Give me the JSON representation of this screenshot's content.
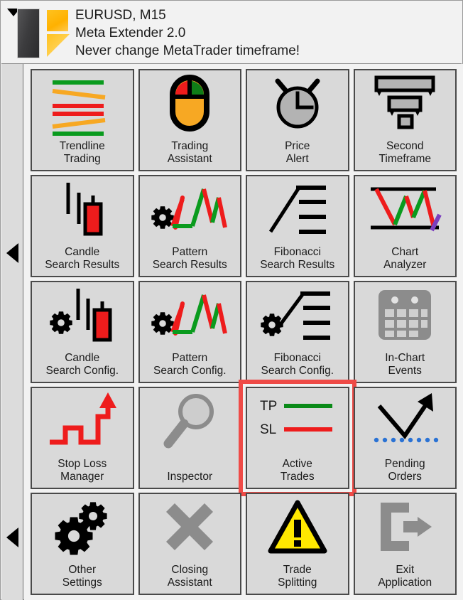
{
  "header": {
    "caret_icon": "chevron-down-icon",
    "logo_icon": "meta-extender-logo",
    "line1": "EURUSD, M15",
    "line2": "Meta Extender 2.0",
    "line3": "Never change MetaTrader timeframe!"
  },
  "rail": {
    "caret_top_icon": "chevron-left-icon",
    "caret_bottom_icon": "chevron-left-icon"
  },
  "colors": {
    "panel_bg": "#f2f2f2",
    "tile_bg": "#d9d9d9",
    "tile_border": "#4a4a4a",
    "rail_bg": "#dcdcdc",
    "selection": "#ef4b47",
    "green": "#0a9b1e",
    "red": "#ee1c1c",
    "orange": "#f7a823",
    "yellow": "#ffe800",
    "purple": "#7b3fbf",
    "blue_dot": "#2a72d4",
    "gray_icon": "#8c8c8c",
    "black": "#000000"
  },
  "tiles": [
    {
      "id": "trendline-trading",
      "icon": "trendlines-icon",
      "label": "Trendline\nTrading",
      "selected": false,
      "disabled": false
    },
    {
      "id": "trading-assistant",
      "icon": "mouse-icon",
      "label": "Trading\nAssistant",
      "selected": false,
      "disabled": false
    },
    {
      "id": "price-alert",
      "icon": "alarm-clock-icon",
      "label": "Price\nAlert",
      "selected": false,
      "disabled": false
    },
    {
      "id": "second-timeframe",
      "icon": "funnel-icon",
      "label": "Second\nTimeframe",
      "selected": false,
      "disabled": false
    },
    {
      "id": "candle-search-results",
      "icon": "candlestick-icon",
      "label": "Candle\nSearch Results",
      "selected": false,
      "disabled": false
    },
    {
      "id": "pattern-search-results",
      "icon": "zigzag-gear-icon",
      "label": "Pattern\nSearch Results",
      "selected": false,
      "disabled": false
    },
    {
      "id": "fibonacci-search-results",
      "icon": "fibonacci-icon",
      "label": "Fibonacci\nSearch Results",
      "selected": false,
      "disabled": false
    },
    {
      "id": "chart-analyzer",
      "icon": "chart-analyzer-icon",
      "label": "Chart\nAnalyzer",
      "selected": false,
      "disabled": false
    },
    {
      "id": "candle-search-config",
      "icon": "candlestick-gear-icon",
      "label": "Candle\nSearch Config.",
      "selected": false,
      "disabled": false
    },
    {
      "id": "pattern-search-config",
      "icon": "zigzag-gear-icon",
      "label": "Pattern\nSearch Config.",
      "selected": false,
      "disabled": false
    },
    {
      "id": "fibonacci-search-config",
      "icon": "fibonacci-gear-icon",
      "label": "Fibonacci\nSearch Config.",
      "selected": false,
      "disabled": false
    },
    {
      "id": "in-chart-events",
      "icon": "calendar-icon",
      "label": "In-Chart\nEvents",
      "selected": false,
      "disabled": true
    },
    {
      "id": "stop-loss-manager",
      "icon": "staircase-arrow-icon",
      "label": "Stop Loss\nManager",
      "selected": false,
      "disabled": false
    },
    {
      "id": "inspector",
      "icon": "magnifier-icon",
      "label": "Inspector",
      "selected": false,
      "disabled": false
    },
    {
      "id": "active-trades",
      "icon": "tp-sl-lines-icon",
      "label": "Active\nTrades",
      "selected": true,
      "disabled": false
    },
    {
      "id": "pending-orders",
      "icon": "pending-arrow-icon",
      "label": "Pending\nOrders",
      "selected": false,
      "disabled": false
    },
    {
      "id": "other-settings",
      "icon": "gears-icon",
      "label": "Other\nSettings",
      "selected": false,
      "disabled": false
    },
    {
      "id": "closing-assistant",
      "icon": "close-x-icon",
      "label": "Closing\nAssistant",
      "selected": false,
      "disabled": true
    },
    {
      "id": "trade-splitting",
      "icon": "warning-triangle-icon",
      "label": "Trade\nSplitting",
      "selected": false,
      "disabled": false
    },
    {
      "id": "exit-application",
      "icon": "exit-arrow-icon",
      "label": "Exit\nApplication",
      "selected": false,
      "disabled": false
    }
  ],
  "active_trades_legend": {
    "tp_label": "TP",
    "sl_label": "SL"
  }
}
